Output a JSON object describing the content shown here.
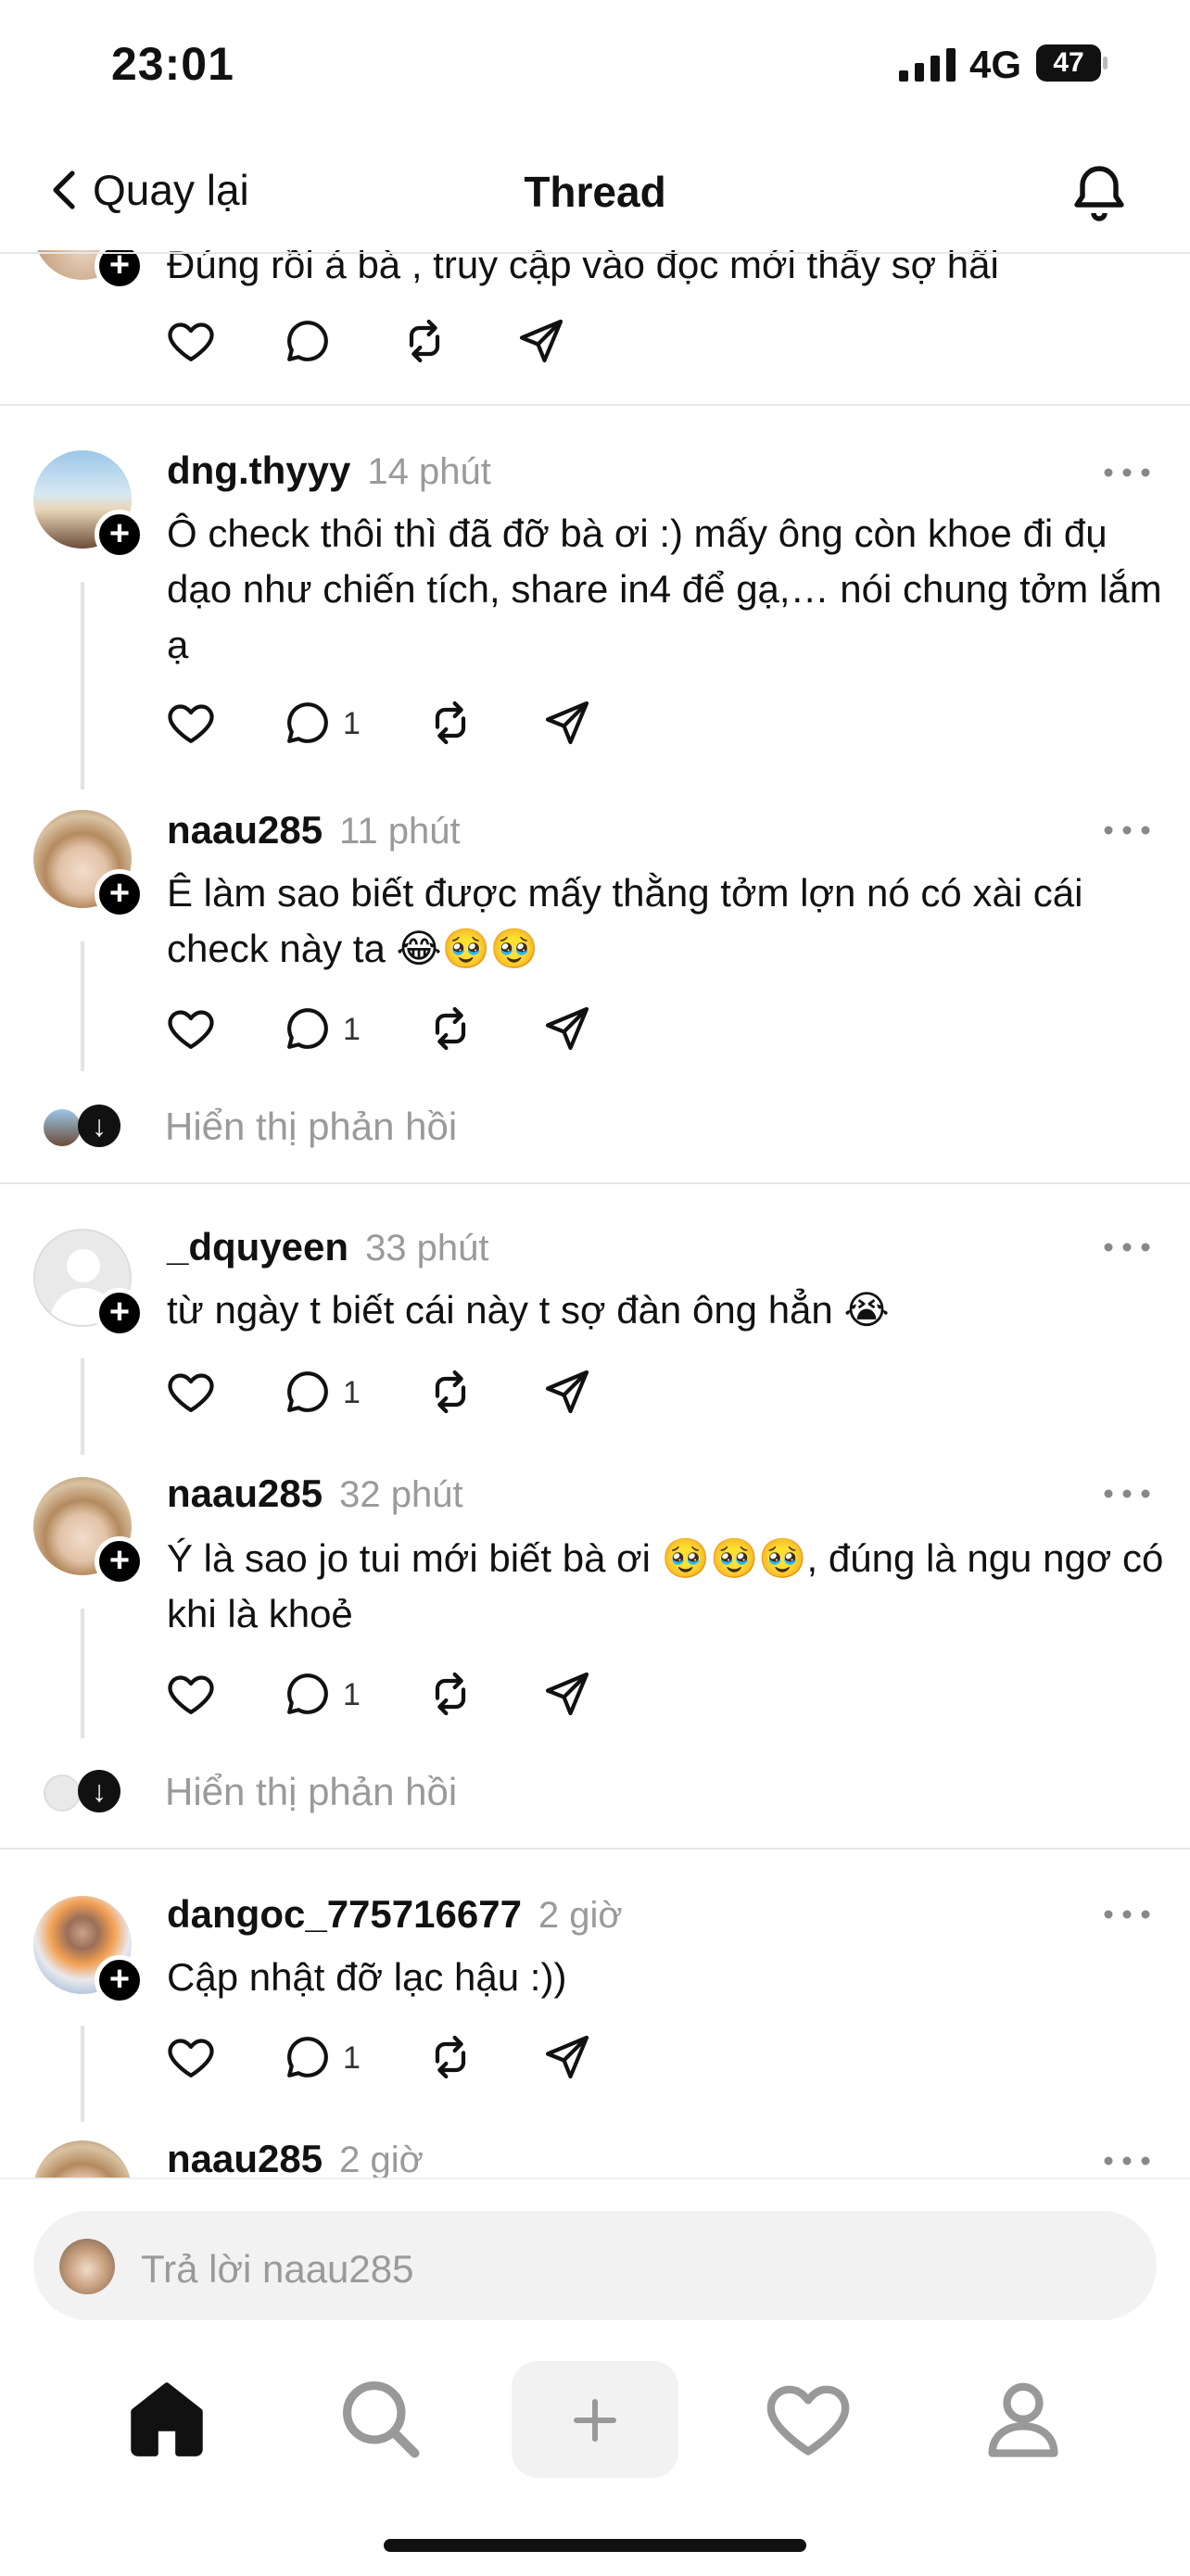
{
  "status_bar": {
    "time": "23:01",
    "network": "4G",
    "battery": "47"
  },
  "nav": {
    "back_label": "Quay lại",
    "title": "Thread"
  },
  "comments": [
    {
      "text": "Đúng rồi á bà , truy cập vào đọc mới thấy sợ hãi"
    },
    {
      "username": "dng.thyyy",
      "time": "14 phút",
      "text": "Ô check thôi thì đã đỡ bà ơi :) mấy ông còn khoe đi đụ dạo như chiến tích, share in4 để gạ,… nói chung tởm lắm ạ",
      "reply_count": "1"
    },
    {
      "username": "naau285",
      "time": "11 phút",
      "text": "Ê làm sao biết được mấy thằng tởm lợn nó có xài cái check này ta 😂🥹🥹",
      "reply_count": "1"
    },
    {
      "username": "_dquyeen",
      "time": "33 phút",
      "text": "từ ngày t biết cái này t sợ đàn ông hẳn 😭",
      "reply_count": "1"
    },
    {
      "username": "naau285",
      "time": "32 phút",
      "text": "Ý là sao jo tui mới biết bà ơi 🥹🥹🥹, đúng là ngu ngơ có khi là khoẻ",
      "reply_count": "1"
    },
    {
      "username": "dangoc_775716677",
      "time": "2 giờ",
      "text": "Cập nhật đỡ lạc hậu :))",
      "reply_count": "1"
    },
    {
      "username": "naau285",
      "time": "2 giờ"
    }
  ],
  "show_replies_label": "Hiển thị phản hồi",
  "reply": {
    "placeholder": "Trả lời naau285"
  },
  "colors": {
    "text": "#111111",
    "secondary": "#9a9a9a",
    "divider": "#e6e6e6",
    "input_bg": "#f2f2f2"
  }
}
